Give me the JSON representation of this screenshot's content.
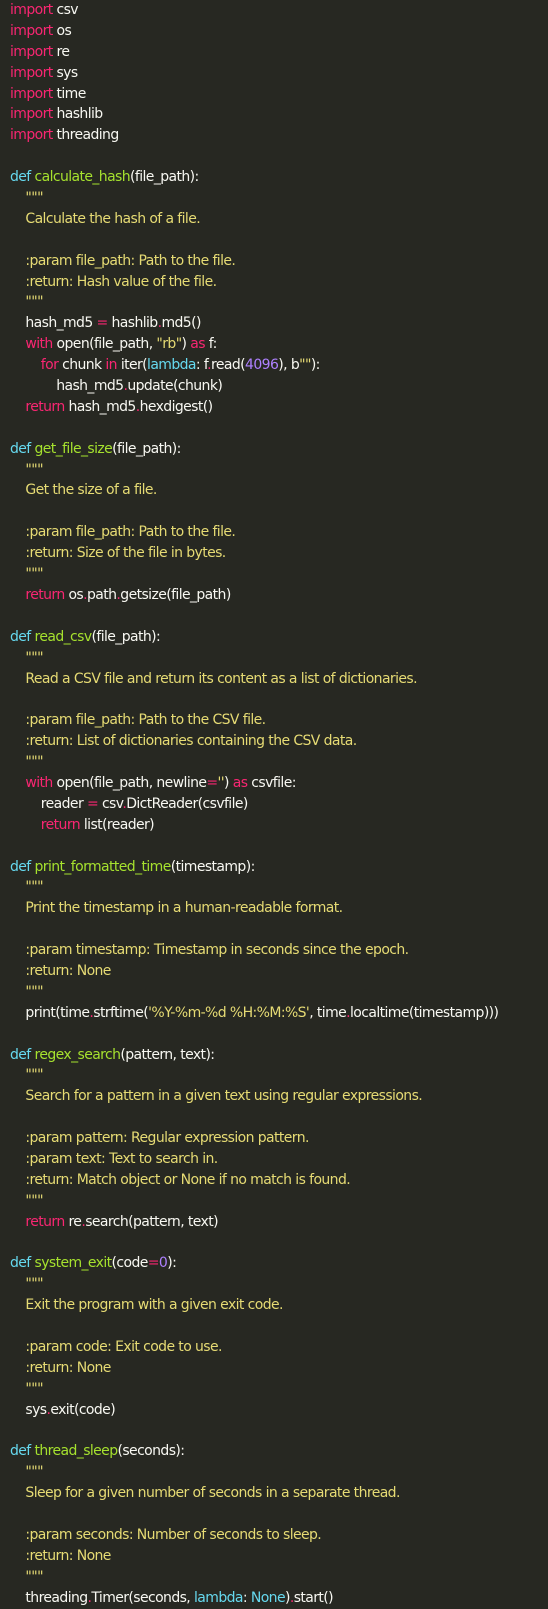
{
  "editor": {
    "language": "python",
    "theme": "monokai",
    "colors": {
      "background": "#272822",
      "plain": "#f8f8f2",
      "keyword": "#f92672",
      "function": "#a6e22e",
      "string": "#e6db74",
      "number": "#ae81ff",
      "builtin": "#66d9ef"
    },
    "lines": [
      [
        [
          "k",
          "import"
        ],
        [
          "p",
          " csv"
        ]
      ],
      [
        [
          "k",
          "import"
        ],
        [
          "p",
          " os"
        ]
      ],
      [
        [
          "k",
          "import"
        ],
        [
          "p",
          " re"
        ]
      ],
      [
        [
          "k",
          "import"
        ],
        [
          "p",
          " sys"
        ]
      ],
      [
        [
          "k",
          "import"
        ],
        [
          "p",
          " time"
        ]
      ],
      [
        [
          "k",
          "import"
        ],
        [
          "p",
          " hashlib"
        ]
      ],
      [
        [
          "k",
          "import"
        ],
        [
          "p",
          " threading"
        ]
      ],
      [],
      [
        [
          "b",
          "def"
        ],
        [
          "p",
          " "
        ],
        [
          "f",
          "calculate_hash"
        ],
        [
          "p",
          "(file_path):"
        ]
      ],
      [
        [
          "s",
          "    \"\"\""
        ]
      ],
      [
        [
          "s",
          "    Calculate the hash of a file."
        ]
      ],
      [],
      [
        [
          "s",
          "    :param file_path: Path to the file."
        ]
      ],
      [
        [
          "s",
          "    :return: Hash value of the file."
        ]
      ],
      [
        [
          "s",
          "    \"\"\""
        ]
      ],
      [
        [
          "p",
          "    hash_md5 "
        ],
        [
          "k",
          "="
        ],
        [
          "p",
          " hashlib"
        ],
        [
          "k",
          "."
        ],
        [
          "p",
          "md5()"
        ]
      ],
      [
        [
          "k",
          "    with"
        ],
        [
          "p",
          " open(file_path, "
        ],
        [
          "s",
          "\"rb\""
        ],
        [
          "p",
          ") "
        ],
        [
          "k",
          "as"
        ],
        [
          "p",
          " f:"
        ]
      ],
      [
        [
          "k",
          "        for"
        ],
        [
          "p",
          " chunk "
        ],
        [
          "k",
          "in"
        ],
        [
          "p",
          " iter("
        ],
        [
          "b",
          "lambda"
        ],
        [
          "p",
          ": f"
        ],
        [
          "k",
          "."
        ],
        [
          "p",
          "read("
        ],
        [
          "n",
          "4096"
        ],
        [
          "p",
          "), b"
        ],
        [
          "s",
          "\"\""
        ],
        [
          "p",
          "):"
        ]
      ],
      [
        [
          "p",
          "            hash_md5"
        ],
        [
          "k",
          "."
        ],
        [
          "p",
          "update(chunk)"
        ]
      ],
      [
        [
          "k",
          "    return"
        ],
        [
          "p",
          " hash_md5"
        ],
        [
          "k",
          "."
        ],
        [
          "p",
          "hexdigest()"
        ]
      ],
      [],
      [
        [
          "b",
          "def"
        ],
        [
          "p",
          " "
        ],
        [
          "f",
          "get_file_size"
        ],
        [
          "p",
          "(file_path):"
        ]
      ],
      [
        [
          "s",
          "    \"\"\""
        ]
      ],
      [
        [
          "s",
          "    Get the size of a file."
        ]
      ],
      [],
      [
        [
          "s",
          "    :param file_path: Path to the file."
        ]
      ],
      [
        [
          "s",
          "    :return: Size of the file in bytes."
        ]
      ],
      [
        [
          "s",
          "    \"\"\""
        ]
      ],
      [
        [
          "k",
          "    return"
        ],
        [
          "p",
          " os"
        ],
        [
          "k",
          "."
        ],
        [
          "p",
          "path"
        ],
        [
          "k",
          "."
        ],
        [
          "p",
          "getsize(file_path)"
        ]
      ],
      [],
      [
        [
          "b",
          "def"
        ],
        [
          "p",
          " "
        ],
        [
          "f",
          "read_csv"
        ],
        [
          "p",
          "(file_path):"
        ]
      ],
      [
        [
          "s",
          "    \"\"\""
        ]
      ],
      [
        [
          "s",
          "    Read a CSV file and return its content as a list of dictionaries."
        ]
      ],
      [],
      [
        [
          "s",
          "    :param file_path: Path to the CSV file."
        ]
      ],
      [
        [
          "s",
          "    :return: List of dictionaries containing the CSV data."
        ]
      ],
      [
        [
          "s",
          "    \"\"\""
        ]
      ],
      [
        [
          "k",
          "    with"
        ],
        [
          "p",
          " open(file_path, newline"
        ],
        [
          "k",
          "="
        ],
        [
          "s",
          "''"
        ],
        [
          "p",
          ") "
        ],
        [
          "k",
          "as"
        ],
        [
          "p",
          " csvfile:"
        ]
      ],
      [
        [
          "p",
          "        reader "
        ],
        [
          "k",
          "="
        ],
        [
          "p",
          " csv"
        ],
        [
          "k",
          "."
        ],
        [
          "p",
          "DictReader(csvfile)"
        ]
      ],
      [
        [
          "k",
          "        return"
        ],
        [
          "p",
          " list(reader)"
        ]
      ],
      [],
      [
        [
          "b",
          "def"
        ],
        [
          "p",
          " "
        ],
        [
          "f",
          "print_formatted_time"
        ],
        [
          "p",
          "(timestamp):"
        ]
      ],
      [
        [
          "s",
          "    \"\"\""
        ]
      ],
      [
        [
          "s",
          "    Print the timestamp in a human-readable format."
        ]
      ],
      [],
      [
        [
          "s",
          "    :param timestamp: Timestamp in seconds since the epoch."
        ]
      ],
      [
        [
          "s",
          "    :return: None"
        ]
      ],
      [
        [
          "s",
          "    \"\"\""
        ]
      ],
      [
        [
          "p",
          "    print(time"
        ],
        [
          "k",
          "."
        ],
        [
          "p",
          "strftime("
        ],
        [
          "s",
          "'%Y-%m-%d %H:%M:%S'"
        ],
        [
          "p",
          ", time"
        ],
        [
          "k",
          "."
        ],
        [
          "p",
          "localtime(timestamp)))"
        ]
      ],
      [],
      [
        [
          "b",
          "def"
        ],
        [
          "p",
          " "
        ],
        [
          "f",
          "regex_search"
        ],
        [
          "p",
          "(pattern, text):"
        ]
      ],
      [
        [
          "s",
          "    \"\"\""
        ]
      ],
      [
        [
          "s",
          "    Search for a pattern in a given text using regular expressions."
        ]
      ],
      [],
      [
        [
          "s",
          "    :param pattern: Regular expression pattern."
        ]
      ],
      [
        [
          "s",
          "    :param text: Text to search in."
        ]
      ],
      [
        [
          "s",
          "    :return: Match object or None if no match is found."
        ]
      ],
      [
        [
          "s",
          "    \"\"\""
        ]
      ],
      [
        [
          "k",
          "    return"
        ],
        [
          "p",
          " re"
        ],
        [
          "k",
          "."
        ],
        [
          "p",
          "search(pattern, text)"
        ]
      ],
      [],
      [
        [
          "b",
          "def"
        ],
        [
          "p",
          " "
        ],
        [
          "f",
          "system_exit"
        ],
        [
          "p",
          "(code"
        ],
        [
          "k",
          "="
        ],
        [
          "n",
          "0"
        ],
        [
          "p",
          "):"
        ]
      ],
      [
        [
          "s",
          "    \"\"\""
        ]
      ],
      [
        [
          "s",
          "    Exit the program with a given exit code."
        ]
      ],
      [],
      [
        [
          "s",
          "    :param code: Exit code to use."
        ]
      ],
      [
        [
          "s",
          "    :return: None"
        ]
      ],
      [
        [
          "s",
          "    \"\"\""
        ]
      ],
      [
        [
          "p",
          "    sys"
        ],
        [
          "k",
          "."
        ],
        [
          "p",
          "exit(code)"
        ]
      ],
      [],
      [
        [
          "b",
          "def"
        ],
        [
          "p",
          " "
        ],
        [
          "f",
          "thread_sleep"
        ],
        [
          "p",
          "(seconds):"
        ]
      ],
      [
        [
          "s",
          "    \"\"\""
        ]
      ],
      [
        [
          "s",
          "    Sleep for a given number of seconds in a separate thread."
        ]
      ],
      [],
      [
        [
          "s",
          "    :param seconds: Number of seconds to sleep."
        ]
      ],
      [
        [
          "s",
          "    :return: None"
        ]
      ],
      [
        [
          "s",
          "    \"\"\""
        ]
      ],
      [
        [
          "p",
          "    threading"
        ],
        [
          "k",
          "."
        ],
        [
          "p",
          "Timer(seconds, "
        ],
        [
          "b",
          "lambda"
        ],
        [
          "p",
          ": "
        ],
        [
          "b",
          "None"
        ],
        [
          "p",
          ")"
        ],
        [
          "k",
          "."
        ],
        [
          "p",
          "start()"
        ]
      ]
    ]
  }
}
